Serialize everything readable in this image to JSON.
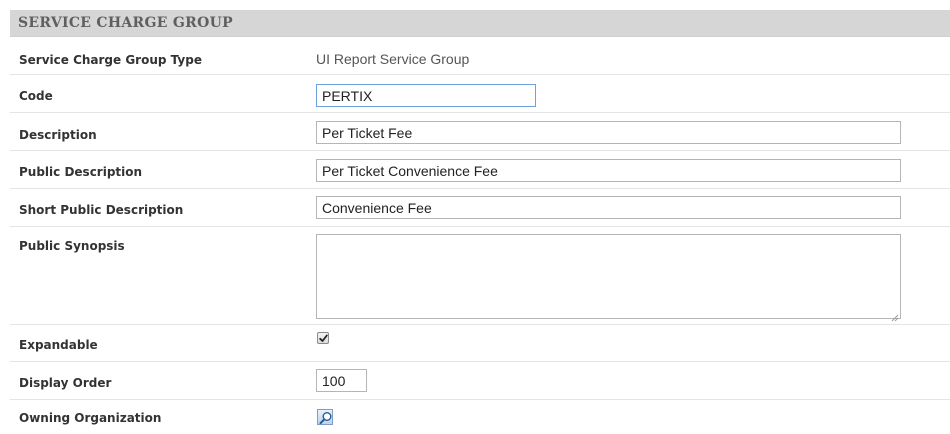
{
  "section": {
    "title": "SERVICE CHARGE GROUP"
  },
  "fields": {
    "group_type": {
      "label": "Service Charge Group Type",
      "value": "UI Report Service Group"
    },
    "code": {
      "label": "Code",
      "value": "PERTIX"
    },
    "description": {
      "label": "Description",
      "value": "Per Ticket Fee"
    },
    "public_description": {
      "label": "Public Description",
      "value": "Per Ticket Convenience Fee"
    },
    "short_public_description": {
      "label": "Short Public Description",
      "value": "Convenience Fee"
    },
    "public_synopsis": {
      "label": "Public Synopsis",
      "value": ""
    },
    "expandable": {
      "label": "Expandable",
      "checked": true
    },
    "display_order": {
      "label": "Display Order",
      "value": "100"
    },
    "owning_organization": {
      "label": "Owning Organization",
      "icon": "magnifier-icon"
    }
  }
}
